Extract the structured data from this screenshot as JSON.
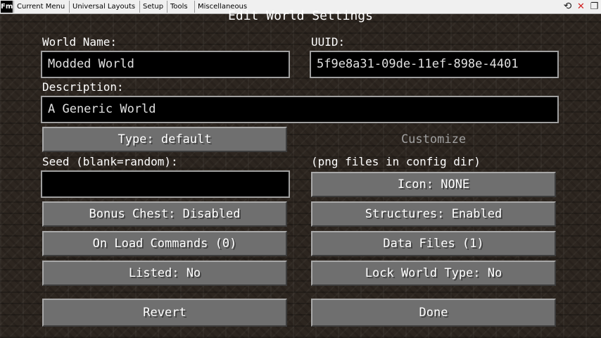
{
  "menubar": {
    "logo": "Fm",
    "items": [
      "Current Menu",
      "Universal Layouts",
      "Setup",
      "Tools",
      "Miscellaneous"
    ],
    "controls": {
      "reload": "⟲",
      "close": "✕",
      "restore": "❐"
    }
  },
  "title": "Edit World Settings",
  "world_name": {
    "label": "World Name:",
    "value": "Modded World"
  },
  "uuid": {
    "label": "UUID:",
    "value": "5f9e8a31-09de-11ef-898e-4401"
  },
  "description": {
    "label": "Description:",
    "value": "A Generic World"
  },
  "type_button": "Type: default",
  "customize_button": "Customize",
  "seed": {
    "label": "Seed (blank=random):",
    "value": ""
  },
  "icon_hint": "(png files in config dir)",
  "icon_button": "Icon: NONE",
  "bonus_chest_button": "Bonus Chest: Disabled",
  "structures_button": "Structures: Enabled",
  "on_load_button": "On Load Commands (0)",
  "data_files_button": "Data Files (1)",
  "listed_button": "Listed: No",
  "lock_world_type_button": "Lock World Type: No",
  "revert_button": "Revert",
  "done_button": "Done"
}
